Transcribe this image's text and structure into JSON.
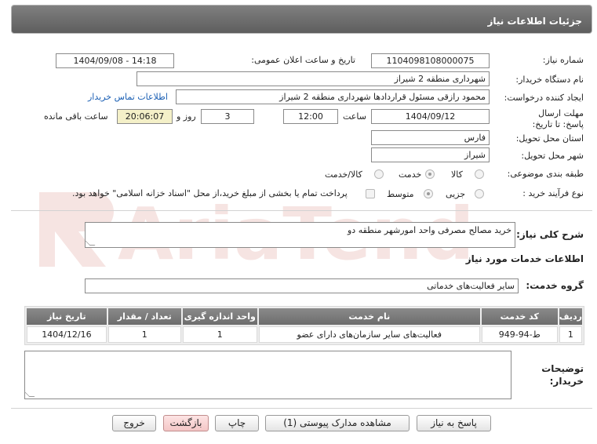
{
  "header": {
    "title": "جزئیات اطلاعات نیاز"
  },
  "form": {
    "need_number_label": "شماره نیاز:",
    "need_number": "1104098108000075",
    "announce_label": "تاریخ و ساعت اعلان عمومی:",
    "announce_value": "1404/09/08 - 14:18",
    "buyer_org_label": "نام دستگاه خریدار:",
    "buyer_org": "شهرداری منطقه 2 شیراز",
    "creator_label": "ایجاد کننده درخواست:",
    "creator": "محمود رازقی مسئول قراردادها شهرداری منطقه 2 شیراز",
    "contact_link": "اطلاعات تماس خریدار",
    "deadline_label": "مهلت ارسال پاسخ: تا تاریخ:",
    "deadline_date": "1404/09/12",
    "time_label": "ساعت",
    "deadline_time": "12:00",
    "days_value": "3",
    "days_label": "روز و",
    "remaining_time": "20:06:07",
    "remaining_label": "ساعت باقی مانده",
    "province_label": "استان محل تحویل:",
    "province": "فارس",
    "city_label": "شهر محل تحویل:",
    "city": "شیراز",
    "category_label": "طبقه بندی موضوعی:",
    "category_options": [
      "کالا",
      "خدمت",
      "کالا/خدمت"
    ],
    "category_selected": "خدمت",
    "process_label": "نوع فرآیند خرید :",
    "process_options": [
      "جزیی",
      "متوسط"
    ],
    "process_selected": "متوسط",
    "payment_note": "پرداخت تمام یا بخشی از مبلغ خرید،از محل \"اسناد خزانه اسلامی\" خواهد بود."
  },
  "summary": {
    "label": "شرح کلی نیاز:",
    "value": "خرید مصالح مصرفی واحد امورشهر منطقه دو"
  },
  "services": {
    "section_title": "اطلاعات خدمات مورد نیاز",
    "group_label": "گروه خدمت:",
    "group_value": "سایر فعالیت‌های خدماتی",
    "columns": [
      "ردیف",
      "کد خدمت",
      "نام خدمت",
      "واحد اندازه گیری",
      "تعداد / مقدار",
      "تاریخ نیاز"
    ],
    "rows": [
      [
        "1",
        "ط-94-949",
        "فعالیت‌های سایر سازمان‌های دارای عضو",
        "1",
        "1",
        "1404/12/16"
      ]
    ]
  },
  "buyer_notes": {
    "label": "توضیحات خریدار:",
    "value": ""
  },
  "buttons": {
    "reply": "پاسخ به نیاز",
    "attachments": "مشاهده مدارک پیوستی (1)",
    "print": "چاپ",
    "back": "بازگشت",
    "exit": "خروج"
  },
  "watermark": {
    "text": "AriaTender.net",
    "color": "#c0392b"
  }
}
